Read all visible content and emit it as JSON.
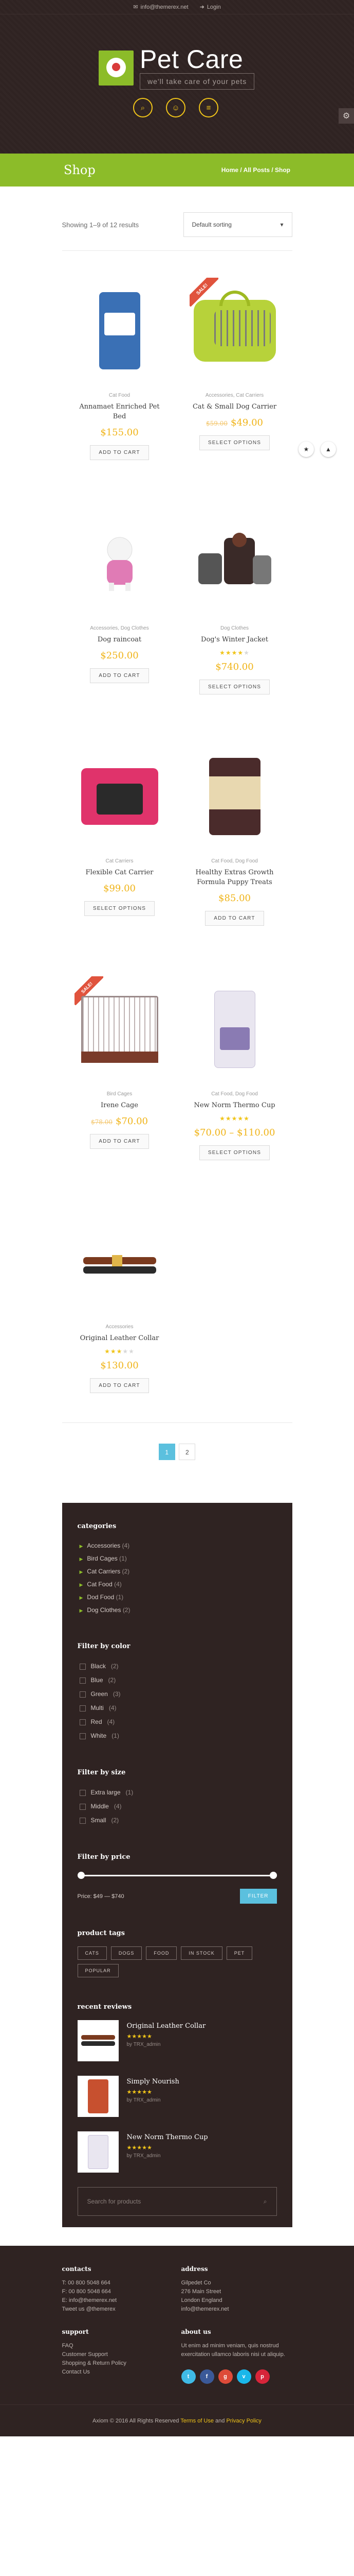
{
  "topbar": {
    "email": "info@themerex.net",
    "login": "Login"
  },
  "logo": {
    "name": "Pet Care",
    "tagline": "we'll take care of your pets"
  },
  "header_icons": [
    "search-icon",
    "user-icon",
    "menu-icon"
  ],
  "page": {
    "title": "Shop",
    "breadcrumbs": "Home / All Posts / Shop"
  },
  "toolbar": {
    "result_count": "Showing 1–9 of 12 results",
    "sort_value": "Default sorting"
  },
  "products": [
    {
      "category": "Cat Food",
      "name": "Annamaet Enriched Pet Bed",
      "price": "$155.00",
      "old_price": "",
      "sale": false,
      "rating": 0,
      "button": "ADD TO CART",
      "image": "food-bag-blue"
    },
    {
      "category": "Accessories, Cat Carriers",
      "name": "Cat & Small Dog Carrier",
      "price": "$49.00",
      "old_price": "$59.00",
      "sale": true,
      "rating": 0,
      "button": "SELECT OPTIONS",
      "image": "green-carrier"
    },
    {
      "category": "Accessories, Dog Clothes",
      "name": "Dog raincoat",
      "price": "$250.00",
      "old_price": "",
      "sale": false,
      "rating": 0,
      "button": "ADD TO CART",
      "image": "dog-pink-coat"
    },
    {
      "category": "Dog Clothes",
      "name": "Dog's Winter Jacket",
      "price": "$740.00",
      "old_price": "",
      "sale": false,
      "rating": 4,
      "button": "SELECT OPTIONS",
      "image": "dog-jackets"
    },
    {
      "category": "Cat Carriers",
      "name": "Flexible Cat Carrier",
      "price": "$99.00",
      "old_price": "",
      "sale": false,
      "rating": 0,
      "button": "SELECT OPTIONS",
      "image": "pink-carrier"
    },
    {
      "category": "Cat Food, Dog Food",
      "name": "Healthy Extras Growth Formula Puppy Treats",
      "price": "$85.00",
      "old_price": "",
      "sale": false,
      "rating": 0,
      "button": "ADD TO CART",
      "image": "natural-choice-can"
    },
    {
      "category": "Bird Cages",
      "name": "Irene Cage",
      "price": "$70.00",
      "old_price": "$78.00",
      "sale": true,
      "rating": 0,
      "button": "ADD TO CART",
      "image": "bird-cage"
    },
    {
      "category": "Cat Food, Dog Food",
      "name": "New Norm Thermo Cup",
      "price": "$70.00 – $110.00",
      "old_price": "",
      "sale": false,
      "rating": 5,
      "button": "SELECT OPTIONS",
      "image": "purina-bag"
    },
    {
      "category": "Accessories",
      "name": "Original Leather Collar",
      "price": "$130.00",
      "old_price": "",
      "sale": false,
      "rating": 3,
      "button": "ADD TO CART",
      "image": "leather-collars"
    }
  ],
  "pagination": {
    "pages": [
      "1",
      "2"
    ],
    "current": "1"
  },
  "sidebar": {
    "categories": {
      "title": "categories",
      "items": [
        {
          "label": "Accessories",
          "count": "(4)"
        },
        {
          "label": "Bird Cages",
          "count": "(1)"
        },
        {
          "label": "Cat Carriers",
          "count": "(2)"
        },
        {
          "label": "Cat Food",
          "count": "(4)"
        },
        {
          "label": "Dod Food",
          "count": "(1)"
        },
        {
          "label": "Dog Clothes",
          "count": "(2)"
        }
      ]
    },
    "color": {
      "title": "Filter by color",
      "items": [
        {
          "label": "Black",
          "count": "(2)"
        },
        {
          "label": "Blue",
          "count": "(2)"
        },
        {
          "label": "Green",
          "count": "(3)"
        },
        {
          "label": "Multi",
          "count": "(4)"
        },
        {
          "label": "Red",
          "count": "(4)"
        },
        {
          "label": "White",
          "count": "(1)"
        }
      ]
    },
    "size": {
      "title": "Filter by size",
      "items": [
        {
          "label": "Extra large",
          "count": "(1)"
        },
        {
          "label": "Middle",
          "count": "(4)"
        },
        {
          "label": "Small",
          "count": "(2)"
        }
      ]
    },
    "price": {
      "title": "Filter by price",
      "range_text": "Price: $49 — $740",
      "button": "FILTER"
    },
    "tags": {
      "title": "product tags",
      "items": [
        "CATS",
        "DOGS",
        "FOOD",
        "IN STOCK",
        "PET",
        "POPULAR"
      ]
    },
    "reviews": {
      "title": "recent reviews",
      "items": [
        {
          "name": "Original Leather Collar",
          "by": "by TRX_admin",
          "rating": 5
        },
        {
          "name": "Simply Nourish",
          "by": "by TRX_admin",
          "rating": 5
        },
        {
          "name": "New Norm Thermo Cup",
          "by": "by TRX_admin",
          "rating": 5
        }
      ]
    },
    "search": {
      "placeholder": "Search for products"
    }
  },
  "footer": {
    "contacts": {
      "title": "contacts",
      "lines": [
        "T: 00 800 5048 664",
        "F: 00 800 5048 664",
        "E: info@themerex.net",
        "Tweet us @themerex"
      ]
    },
    "address": {
      "title": "address",
      "lines": [
        "Gilpedet Co",
        "276 Main Street",
        "London England",
        "info@themerex.net"
      ]
    },
    "support": {
      "title": "support",
      "lines": [
        "FAQ",
        "Customer Support",
        "Shopping & Return Policy",
        "Contact Us"
      ]
    },
    "about": {
      "title": "about us",
      "text": "Ut enim ad minim veniam, quis nostrud exercitation ullamco laboris nisi ut aliquip."
    },
    "socials": [
      {
        "name": "twitter-icon",
        "glyph": "t",
        "color": "#3fbae6"
      },
      {
        "name": "facebook-icon",
        "glyph": "f",
        "color": "#3b5998"
      },
      {
        "name": "google-plus-icon",
        "glyph": "g",
        "color": "#dd4b39"
      },
      {
        "name": "vimeo-icon",
        "glyph": "v",
        "color": "#1ab7ea"
      },
      {
        "name": "pinterest-icon",
        "glyph": "p",
        "color": "#d7253a"
      }
    ],
    "copyright_a": "Axiom © 2016 All Rights Reserved ",
    "copyright_b": "Terms of Use",
    "copyright_c": " and ",
    "copyright_d": "Privacy Policy"
  },
  "colors": {
    "accent_green": "#8cbc29",
    "accent_yellow": "#f0c419",
    "dark_brown": "#2f2322",
    "sale_red": "#e0533d",
    "button_blue": "#5bc0de"
  }
}
